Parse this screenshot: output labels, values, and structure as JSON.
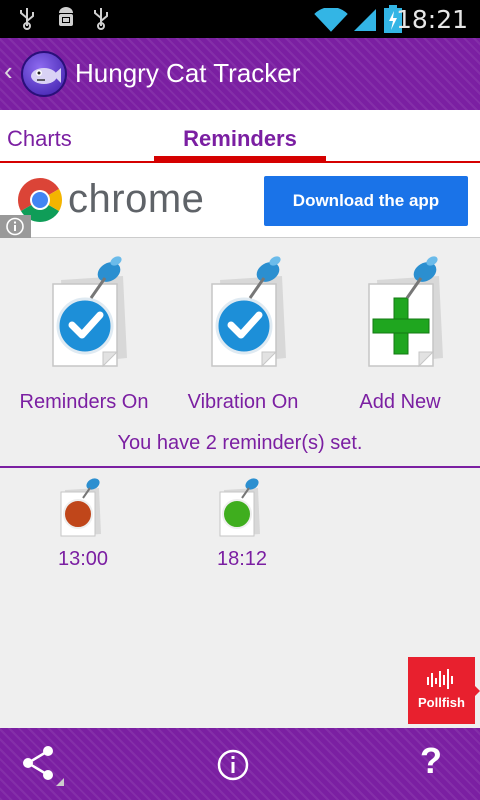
{
  "status_bar": {
    "time": "18:21",
    "left_icons": [
      "usb-icon",
      "android-debug-icon",
      "usb-icon"
    ],
    "right_icons": [
      "wifi-icon",
      "signal-icon",
      "battery-charging-icon"
    ]
  },
  "action_bar": {
    "title": "Hungry Cat Tracker",
    "up_glyph": "‹",
    "logo_icon": "cat-fish-logo-icon"
  },
  "tabs": [
    {
      "label": "Charts",
      "selected": false
    },
    {
      "label": "Reminders",
      "selected": true
    }
  ],
  "ad": {
    "brand": "chrome",
    "button_label": "Download the app",
    "info_icon": "info-icon"
  },
  "actions": [
    {
      "label": "Reminders On",
      "icon": "pinned-note-checkmark-icon"
    },
    {
      "label": "Vibration On",
      "icon": "pinned-note-checkmark-icon"
    },
    {
      "label": "Add New",
      "icon": "pinned-note-plus-icon"
    }
  ],
  "summary": "You have 2 reminder(s) set.",
  "reminders": [
    {
      "time": "13:00",
      "status_color": "#c0461a"
    },
    {
      "time": "18:12",
      "status_color": "#3fae1e"
    }
  ],
  "pollfish": {
    "label": "Pollfish"
  },
  "bottom_bar": {
    "icons": [
      "share-icon",
      "info-icon",
      "help-icon"
    ],
    "help_glyph": "?"
  },
  "colors": {
    "accent": "#7b1fa2",
    "tab_indicator": "#d50000",
    "ad_button": "#1a73e8",
    "pollfish": "#e8202e"
  }
}
